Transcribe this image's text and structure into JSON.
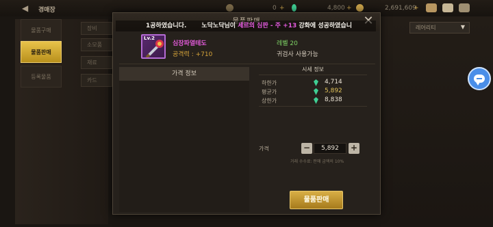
{
  "topbar": {
    "back_icon": "back-arrow-icon",
    "title": "경매장",
    "currency1": "0",
    "currency2": "4,800",
    "currency3": "2,691,609",
    "plus": "+",
    "icons": [
      "chest-icon",
      "mail-icon",
      "menu-icon"
    ]
  },
  "left_tabs": [
    {
      "label": "물품구매",
      "active": false
    },
    {
      "label": "물품판매",
      "active": true
    },
    {
      "label": "등록물품",
      "active": false
    }
  ],
  "sub_tabs": [
    "장비",
    "소모품",
    "재료",
    "카드"
  ],
  "dropdown": {
    "label": "레어리티"
  },
  "modal": {
    "title": "물품판매",
    "close_icon": "close-icon",
    "notice": {
      "part1": "1공하였습니다.",
      "part2": "노닥노닥님이 ",
      "highlight": "세르의 심판 - 주 +13",
      "part3": " 강화에 성공하였습니"
    },
    "item": {
      "level_badge": "Lv.2",
      "name": "심장파열테도",
      "attack": "공격력 : +710",
      "required_level": "레벨 20",
      "class_restriction": "귀검사 사용가능"
    },
    "price_info_header": "가격 정보",
    "market_info_header": "시세 정보",
    "market_prices": [
      {
        "label": "하한가",
        "value": "4,714",
        "highlight": false
      },
      {
        "label": "평균가",
        "value": "5,892",
        "highlight": true
      },
      {
        "label": "상한가",
        "value": "8,838",
        "highlight": false
      }
    ],
    "price_label": "가격",
    "price_value": "5,892",
    "minus": "−",
    "plus": "+",
    "fee_note": "거래 수수료: 판매 금액의 10%",
    "sell_button": "물품판매"
  },
  "colors": {
    "accent_gold": "#d8ae46",
    "epic_purple": "#e15ad8",
    "level_green": "#7fd466",
    "gem_green": "#3fcf94"
  }
}
